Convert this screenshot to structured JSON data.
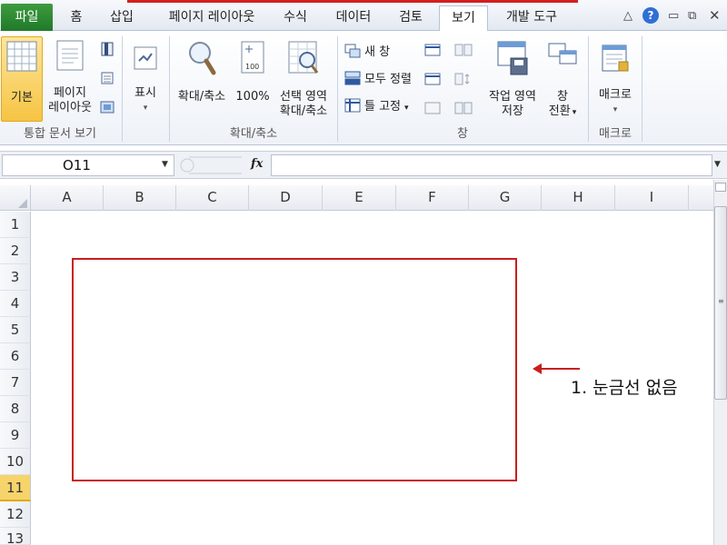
{
  "tabs": {
    "file": "파일",
    "home": "홈",
    "insert": "삽입",
    "page_layout": "페이지 레이아웃",
    "formulas": "수식",
    "data": "데이터",
    "review": "검토",
    "view": "보기",
    "developer": "개발 도구",
    "help": "?"
  },
  "ribbon": {
    "workbook_views": {
      "normal": "기본",
      "page_layout_line1": "페이지",
      "page_layout_line2": "레이아웃",
      "label": "통합 문서 보기"
    },
    "show": {
      "label": "표시"
    },
    "zoom": {
      "zoom": "확대/축소",
      "zoom100": "100%",
      "zoom_sel_line1": "선택 영역",
      "zoom_sel_line2": "확대/축소",
      "label": "확대/축소"
    },
    "window": {
      "new_window": "새 창",
      "arrange_all": "모두 정렬",
      "freeze_panes": "틀 고정",
      "save_workspace_line1": "작업 영역",
      "save_workspace_line2": "저장",
      "switch_line1": "창",
      "switch_line2": "전환",
      "label": "창"
    },
    "macros": {
      "macros": "매크로",
      "label": "매크로"
    }
  },
  "formula_bar": {
    "name_box": "O11",
    "fx": "fx",
    "value": ""
  },
  "grid": {
    "columns": [
      "A",
      "B",
      "C",
      "D",
      "E",
      "F",
      "G",
      "H",
      "I"
    ],
    "rows": [
      "1",
      "2",
      "3",
      "4",
      "5",
      "6",
      "7",
      "8",
      "9",
      "10",
      "11",
      "12",
      "13"
    ],
    "active_row": "11",
    "gridlines": false
  },
  "annotation": {
    "text": "1. 눈금선 없음",
    "color": "#c81e1e"
  },
  "colors": {
    "file_tab": "#2a8a33",
    "accent": "#f6d46b",
    "annotation": "#c81e1e"
  }
}
